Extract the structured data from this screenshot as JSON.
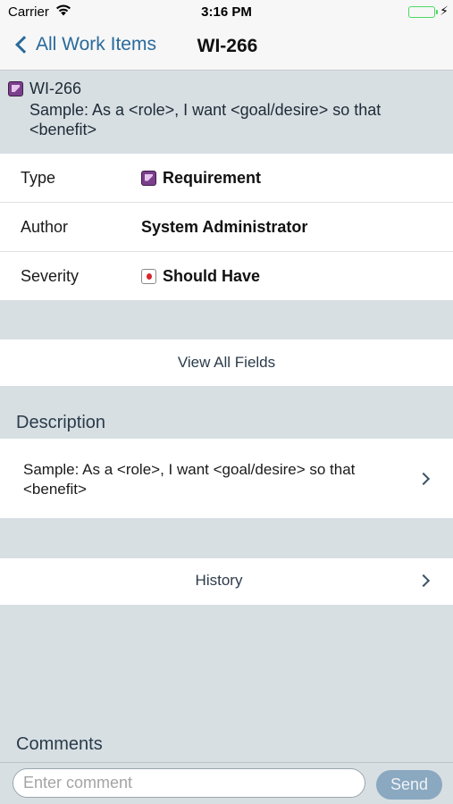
{
  "status_bar": {
    "carrier": "Carrier",
    "time": "3:16 PM",
    "battery_level": 1.0
  },
  "nav": {
    "back_label": "All Work Items",
    "title": "WI-266"
  },
  "header": {
    "id": "WI-266",
    "summary": "Sample: As a <role>, I want <goal/desire> so that <benefit>",
    "icon": "requirement-icon"
  },
  "fields": [
    {
      "label": "Type",
      "value": "Requirement",
      "icon": "requirement-icon"
    },
    {
      "label": "Author",
      "value": "System Administrator"
    },
    {
      "label": "Severity",
      "value": "Should Have",
      "icon": "severity-should-have-icon"
    }
  ],
  "view_all_label": "View All Fields",
  "description": {
    "title": "Description",
    "text": "Sample: As a <role>, I want <goal/desire> so that <benefit>"
  },
  "history_label": "History",
  "comments": {
    "title": "Comments",
    "placeholder": "Enter comment",
    "send_label": "Send"
  },
  "colors": {
    "accent": "#2a6a9c",
    "background": "#d7dfe3",
    "send_button": "#8aa8c0",
    "battery": "#4cd964"
  }
}
